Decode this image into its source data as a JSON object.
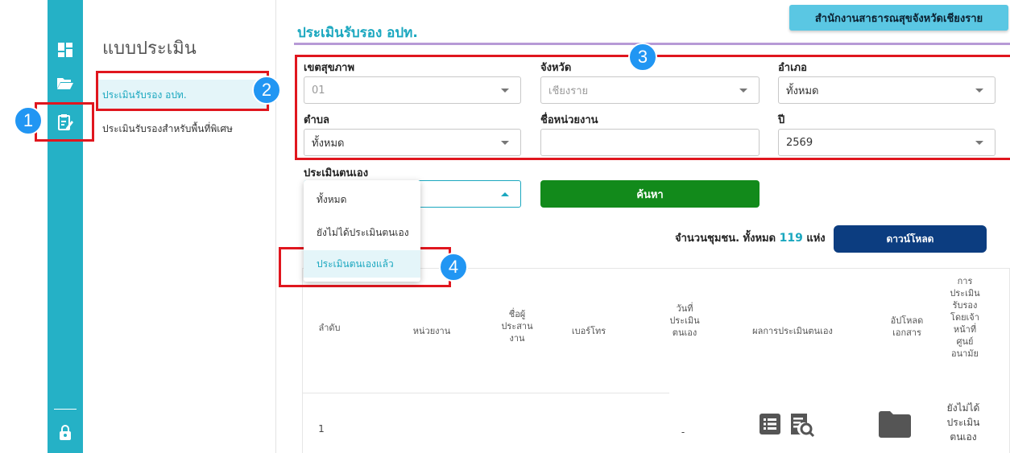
{
  "submenu": {
    "title": "แบบประเมิน",
    "items": [
      {
        "label": "ประเมินรับรอง อปท."
      },
      {
        "label": "ประเมินรับรองสำหรับพื้นที่พิเศษ"
      }
    ]
  },
  "header": {
    "title": "ประเมินรับรอง อปท.",
    "org_badge": "สำนักงานสาธารณสุขจังหวัดเชียงราย"
  },
  "filters": {
    "region": {
      "label": "เขตสุขภาพ",
      "value": "01"
    },
    "province": {
      "label": "จังหวัด",
      "value": "เชียงราย"
    },
    "district": {
      "label": "อำเภอ",
      "value": "ทั้งหมด"
    },
    "subdistrict": {
      "label": "ตำบล",
      "value": "ทั้งหมด"
    },
    "unit_name": {
      "label": "ชื่อหน่วยงาน",
      "value": ""
    },
    "year": {
      "label": "ปี",
      "value": "2569"
    },
    "self_assess": {
      "label": "ประเมินตนเอง",
      "value": ""
    }
  },
  "dropdown": {
    "options": [
      "ทั้งหมด",
      "ยังไม่ได้ประเมินตนเอง",
      "ประเมินตนเองแล้ว"
    ]
  },
  "actions": {
    "search_label": "ค้นหา",
    "download_label": "ดาวน์โหลด"
  },
  "summary": {
    "prefix": "จำนวนชุมชน. ทั้งหมด",
    "count": "119",
    "suffix": "แห่ง"
  },
  "table": {
    "headers": [
      "ลำดับ",
      "หน่วยงาน",
      "ชื่อผู้ประสานงาน",
      "เบอร์โทร",
      "วันที่ประเมินตนเอง",
      "ผลการประเมินตนเอง",
      "อัปโหลดเอกสาร",
      "การประเมินรับรองโดยเจ้าหน้าที่ศูนย์อนามัย"
    ],
    "rows": [
      {
        "index": "1",
        "date": "-",
        "status": "ยังไม่ได้ประเมินตนเอง"
      }
    ]
  },
  "annotations": [
    "1",
    "2",
    "3",
    "4"
  ],
  "colors": {
    "rail": "#25b1c6",
    "accent": "#1aa7bf",
    "search_button": "#128a1b",
    "download_button": "#0c3d80",
    "annotation_red": "#e0161e",
    "annotation_blue": "#2196f3"
  }
}
